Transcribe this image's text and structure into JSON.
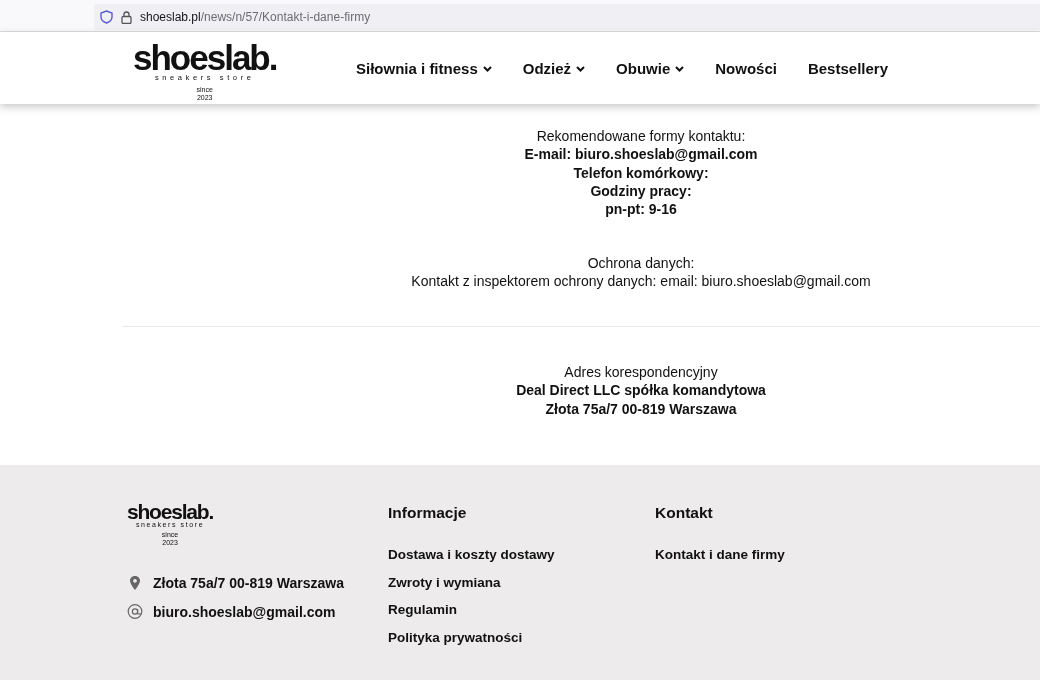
{
  "browser": {
    "url_domain": "shoeslab.pl",
    "url_path": "/news/n/57/Kontakt-i-dane-firmy"
  },
  "header": {
    "logo": {
      "wordmark": "shoeslab.",
      "tagline": "sneakers store",
      "since": "since",
      "year": "2023"
    },
    "nav": [
      {
        "label": "Siłownia i fitness",
        "has_dropdown": true
      },
      {
        "label": "Odzież",
        "has_dropdown": true
      },
      {
        "label": "Obuwie",
        "has_dropdown": true
      },
      {
        "label": "Nowości",
        "has_dropdown": false
      },
      {
        "label": "Bestsellery",
        "has_dropdown": false
      }
    ]
  },
  "content": {
    "blocks": [
      {
        "kind": "text",
        "lines": [
          {
            "text": "Rekomendowane formy kontaktu:",
            "bold": false
          },
          {
            "text": "E-mail: biuro.shoeslab@gmail.com",
            "bold": true
          },
          {
            "text": "Telefon komórkowy:",
            "bold": true
          },
          {
            "text": "Godziny pracy:",
            "bold": true
          },
          {
            "text": "pn-pt: 9-16",
            "bold": true
          }
        ]
      },
      {
        "kind": "text",
        "lines": [
          {
            "text": "Ochrona danych:",
            "bold": false
          },
          {
            "text": "Kontakt z inspektorem ochrony danych: email: biuro.shoeslab@gmail.com",
            "bold": false
          }
        ]
      },
      {
        "kind": "divider"
      },
      {
        "kind": "text",
        "lines": [
          {
            "text": "Adres korespondencyjny",
            "bold": false
          },
          {
            "text": "Deal Direct LLC spółka komandytowa",
            "bold": true
          },
          {
            "text": "Złota 75a/7 00-819 Warszawa",
            "bold": true
          }
        ]
      }
    ]
  },
  "footer": {
    "logo": {
      "wordmark": "shoeslab.",
      "tagline": "sneakers store",
      "since": "since",
      "year": "2023"
    },
    "contact": [
      {
        "kind": "address",
        "text": "Złota 75a/7 00-819 Warszawa"
      },
      {
        "kind": "email",
        "text": "biuro.shoeslab@gmail.com"
      }
    ],
    "columns": [
      {
        "heading": "Informacje",
        "links": [
          "Dostawa i koszty dostawy",
          "Zwroty i wymiana",
          "Regulamin",
          "Polityka prywatności"
        ]
      },
      {
        "heading": "Kontakt",
        "links": [
          "Kontakt i dane firmy"
        ]
      }
    ]
  }
}
